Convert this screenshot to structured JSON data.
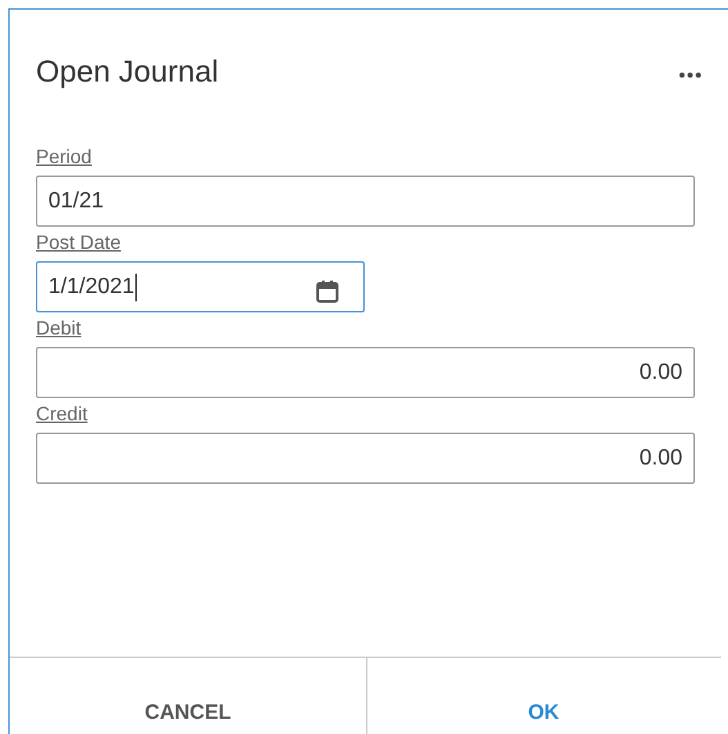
{
  "dialog": {
    "title": "Open Journal",
    "menu": "•••"
  },
  "fields": [
    {
      "label": "Period",
      "value": "01/21",
      "kind": "text",
      "focused": false
    },
    {
      "label": "Post Date",
      "value": "1/1/2021",
      "kind": "date",
      "focused": true
    },
    {
      "label": "Debit",
      "value": "0.00",
      "kind": "number",
      "focused": false
    },
    {
      "label": "Credit",
      "value": "0.00",
      "kind": "number",
      "focused": false
    }
  ],
  "buttons": [
    {
      "label": "CANCEL",
      "primary": false
    },
    {
      "label": "OK",
      "primary": true
    }
  ]
}
